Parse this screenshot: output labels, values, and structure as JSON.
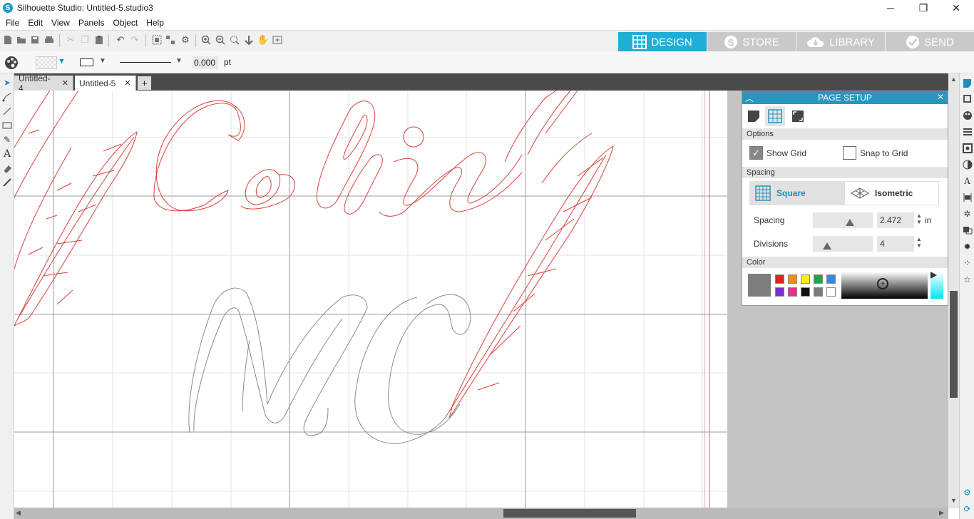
{
  "window": {
    "title": "Silhouette Studio: Untitled-5.studio3",
    "logo": "S",
    "minimize": "─",
    "maximize": "❐",
    "close": "✕"
  },
  "menu": [
    "File",
    "Edit",
    "View",
    "Panels",
    "Object",
    "Help"
  ],
  "modes": [
    {
      "label": "DESIGN",
      "active": true
    },
    {
      "label": "STORE",
      "active": false
    },
    {
      "label": "LIBRARY",
      "active": false
    },
    {
      "label": "SEND",
      "active": false
    }
  ],
  "propbar": {
    "line_width": "0.000",
    "unit": "pt"
  },
  "tabs": [
    {
      "label": "Untitled-4",
      "close": "✕"
    },
    {
      "label": "Untitled-5",
      "close": "✕"
    }
  ],
  "add_tab": "+",
  "panel": {
    "title": "PAGE SETUP",
    "options_header": "Options",
    "show_grid": {
      "label": "Show Grid",
      "checked": true
    },
    "snap_to_grid": {
      "label": "Snap to Grid",
      "checked": false
    },
    "spacing_header": "Spacing",
    "square_label": "Square",
    "isometric_label": "Isometric",
    "spacing": {
      "label": "Spacing",
      "value": "2.472",
      "unit": "in"
    },
    "divisions": {
      "label": "Divisions",
      "value": "4"
    },
    "color_header": "Color",
    "swatch_colors": [
      "#e2231a",
      "#f28b1e",
      "#f7ec13",
      "#1ea54a",
      "#3b86e5",
      "#7b2fd0",
      "#e8308a",
      "#111111",
      "#7a7a7a",
      "#ffffff"
    ]
  },
  "colors": {
    "accent": "#20aed6",
    "cut_line": "#d9413a",
    "grid_line": "#888888"
  }
}
